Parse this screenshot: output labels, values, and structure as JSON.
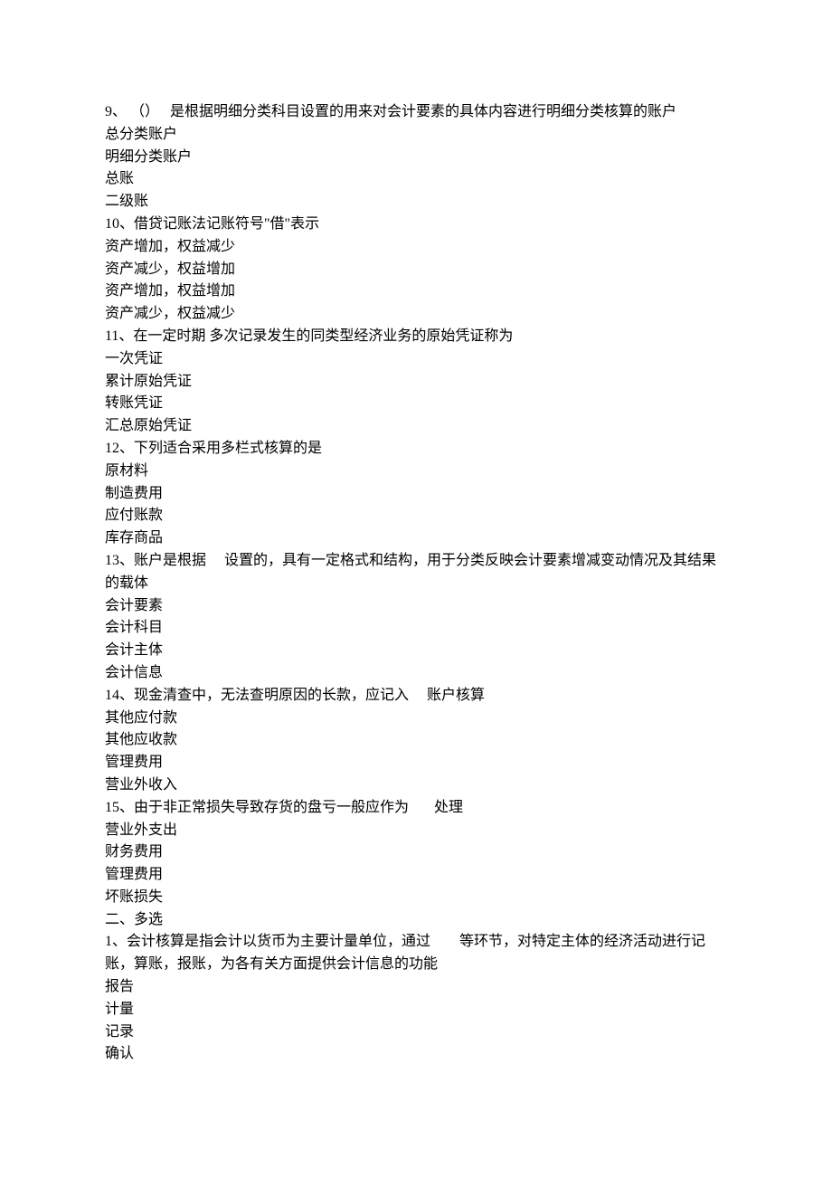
{
  "questions": [
    {
      "stem": "9、 （）   是根据明细分类科目设置的用来对会计要素的具体内容进行明细分类核算的账户",
      "options": [
        "总分类账户",
        "明细分类账户",
        "总账",
        "二级账"
      ]
    },
    {
      "stem": "10、借贷记账法记账符号\"借\"表示",
      "options": [
        "资产增加，权益减少",
        "资产减少，权益增加",
        "资产增加，权益增加",
        "资产减少，权益减少"
      ]
    },
    {
      "stem": "11、在一定时期 多次记录发生的同类型经济业务的原始凭证称为",
      "options": [
        "一次凭证",
        "累计原始凭证",
        "转账凭证",
        "汇总原始凭证"
      ]
    },
    {
      "stem": "12、下列适合采用多栏式核算的是",
      "options": [
        "原材料",
        "制造费用",
        "应付账款",
        "库存商品"
      ]
    },
    {
      "stem": "13、账户是根据     设置的，具有一定格式和结构，用于分类反映会计要素增减变动情况及其结果的载体",
      "options": [
        "会计要素",
        "会计科目",
        "会计主体",
        "会计信息"
      ]
    },
    {
      "stem": "14、现金清查中，无法查明原因的长款，应记入     账户核算",
      "options": [
        "其他应付款",
        "其他应收款",
        "管理费用",
        "营业外收入"
      ]
    },
    {
      "stem": "15、由于非正常损失导致存货的盘亏一般应作为       处理",
      "options": [
        "营业外支出",
        "财务费用",
        "管理费用",
        "坏账损失"
      ]
    }
  ],
  "section2_heading": "二、多选",
  "section2_questions": [
    {
      "stem": "1、会计核算是指会计以货币为主要计量单位，通过        等环节，对特定主体的经济活动进行记账，算账，报账，为各有关方面提供会计信息的功能",
      "options": [
        "报告",
        "计量",
        "记录",
        "确认"
      ]
    }
  ]
}
